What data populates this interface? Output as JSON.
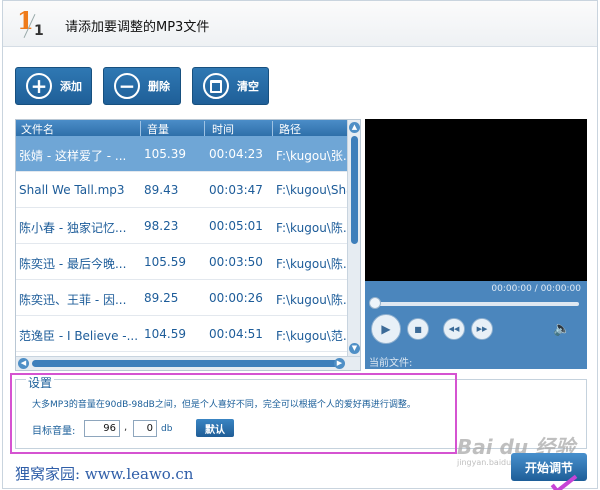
{
  "header": {
    "step": "1",
    "step_total": "1",
    "title": "请添加要调整的MP3文件"
  },
  "toolbar": {
    "add_label": "添加",
    "delete_label": "删除",
    "clear_label": "清空"
  },
  "file_list": {
    "columns": {
      "name": "文件名",
      "volume": "音量",
      "time": "时间",
      "path": "路径"
    },
    "rows": [
      {
        "name": "张婧 - 这样爱了 - ...",
        "volume": "105.39",
        "time": "00:04:23",
        "path": "F:\\kugou\\张...",
        "selected": true
      },
      {
        "name": "Shall We Tall.mp3",
        "volume": "89.43",
        "time": "00:03:47",
        "path": "F:\\kugou\\Sha..."
      },
      {
        "name": "陈小春 - 独家记忆...",
        "volume": "98.23",
        "time": "00:05:01",
        "path": "F:\\kugou\\陈..."
      },
      {
        "name": "陈奕迅 - 最后今晚...",
        "volume": "105.59",
        "time": "00:03:50",
        "path": "F:\\kugou\\陈..."
      },
      {
        "name": "陈奕迅、王菲 - 因...",
        "volume": "89.25",
        "time": "00:00:26",
        "path": "F:\\kugou\\陈..."
      },
      {
        "name": "范逸臣 - I Believe -...",
        "volume": "104.59",
        "time": "00:04:51",
        "path": "F:\\kugou\\范..."
      }
    ]
  },
  "player": {
    "time_display": "00:00:00 / 00:00:00",
    "current_file_label": "当前文件:",
    "progress": 0
  },
  "settings": {
    "legend": "设置",
    "description": "大多MP3的音量在90dB-98dB之间，但是个人喜好不同，完全可以根据个人的爱好再进行调整。",
    "target_label": "目标音量:",
    "target_int": "96",
    "separator": ",",
    "target_dec": "0",
    "unit": "db",
    "default_button": "默认"
  },
  "footer": {
    "brand": "狸窝家园: www.leawo.cn",
    "start_button": "开始调节"
  },
  "watermark": {
    "main": "Bai du 经验",
    "sub": "jingyan.baidu.com"
  },
  "colors": {
    "accent": "#2a6cab",
    "brand_orange": "#ef7b1a",
    "highlight": "#d553d1",
    "selected_row": "#6fa6d6"
  }
}
